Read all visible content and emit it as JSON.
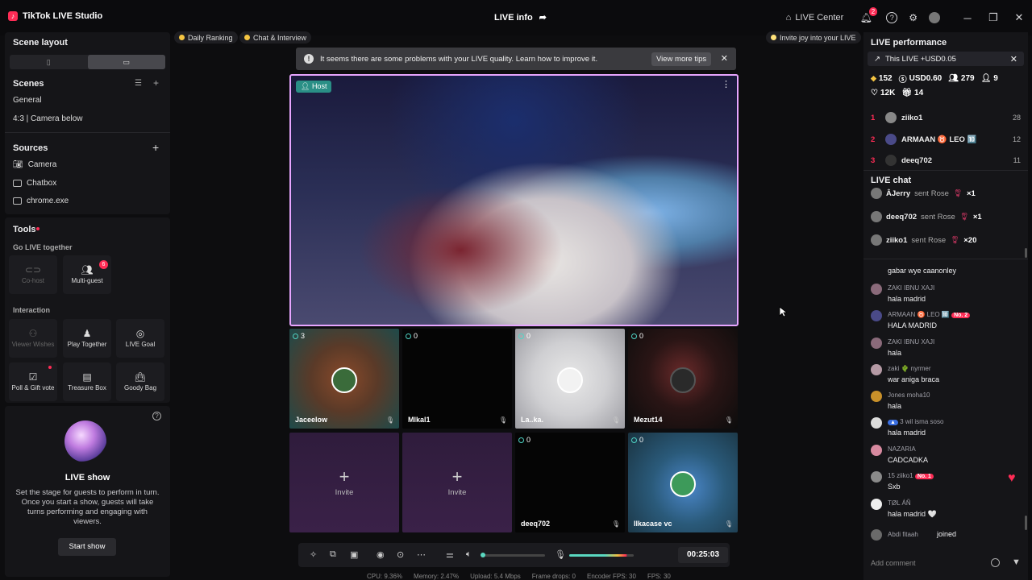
{
  "titlebar": {
    "app_title": "TikTok LIVE Studio",
    "live_info": "LIVE info",
    "live_center": "LIVE Center",
    "notif_count": "2"
  },
  "left": {
    "scene_layout": "Scene layout",
    "scenes": "Scenes",
    "scene_items": [
      "General",
      "4:3 | Camera below"
    ],
    "sources": "Sources",
    "source_items": [
      "Camera",
      "Chatbox",
      "chrome.exe"
    ],
    "tools": "Tools",
    "go_live_together": "Go LIVE together",
    "cohost": "Co-host",
    "multiguest": "Multi-guest",
    "multiguest_badge": "6",
    "interaction": "Interaction",
    "viewer_wishes": "Viewer Wishes",
    "play_together": "Play Together",
    "live_goal": "LIVE Goal",
    "poll_gift": "Poll & Gift vote",
    "treasure_box": "Treasure Box",
    "goody_bag": "Goody Bag",
    "live_show_title": "LIVE show",
    "live_show_desc": "Set the stage for guests to perform in turn. Once you start a show, guests will take turns performing and engaging with viewers.",
    "start_show": "Start show"
  },
  "center": {
    "daily_ranking": "Daily Ranking",
    "chat_interview": "Chat & Interview",
    "invite_joy": "Invite joy into your LIVE",
    "alert_text": "It seems there are some problems with your LIVE quality. Learn how to improve it.",
    "view_more_tips": "View more tips",
    "host_tag": "Host",
    "guests": [
      {
        "count": "3",
        "name": "Jaceelow"
      },
      {
        "count": "0",
        "name": "Mlkal1"
      },
      {
        "count": "0",
        "name": "La..ka."
      },
      {
        "count": "0",
        "name": "Mezut14"
      },
      {
        "count": "0",
        "name": "deeq702"
      },
      {
        "count": "0",
        "name": "Ilkacase vc"
      }
    ],
    "invite_label": "Invite",
    "timer": "00:25:03",
    "stats": [
      "CPU: 9.36%",
      "Memory: 2.47%",
      "Upload: 5.4 Mbps",
      "Frame drops: 0",
      "Encoder FPS: 30",
      "FPS: 30"
    ]
  },
  "right": {
    "live_performance": "LIVE performance",
    "this_live": "This LIVE +USD0.05",
    "metrics": {
      "diamonds": "152",
      "usd": "USD0.60",
      "viewers": "279",
      "new_followers": "9",
      "likes": "12K",
      "gifters": "14"
    },
    "ranking": [
      {
        "rank": "1",
        "name": "ziiko1",
        "score": "28"
      },
      {
        "rank": "2",
        "name": "ARMAAN ♉ LEO 🔟",
        "score": "12"
      },
      {
        "rank": "3",
        "name": "deeq702",
        "score": "11"
      }
    ],
    "live_chat": "LIVE chat",
    "gifts": [
      {
        "user": "ÂJerry",
        "sent": "sent Rose",
        "count": "×1"
      },
      {
        "user": "deeq702",
        "sent": "sent Rose",
        "count": "×1"
      },
      {
        "user": "ziiko1",
        "sent": "sent Rose",
        "count": "×20"
      }
    ],
    "chat": [
      {
        "user": "",
        "msg": "gabar wye caanonley"
      },
      {
        "user": "ZAKI IBNU XAJI",
        "msg": "hala madrid"
      },
      {
        "user": "ARMAAN ♉ LEO 🔟",
        "badge": "No. 2",
        "msg": "HALA MADRID"
      },
      {
        "user": "ZAKI IBNU XAJI",
        "msg": "hala"
      },
      {
        "user": "zaki 🌵 nyrmer",
        "msg": "war aniga braca"
      },
      {
        "user": "Jones moha10",
        "msg": "hala"
      },
      {
        "user": "3 wil isma soso",
        "msg": "hala madrid"
      },
      {
        "user": "NAZARIA",
        "msg": "CADCADKA"
      },
      {
        "user": "15 ziiko1",
        "badge": "No. 1",
        "msg": "Sxb"
      },
      {
        "user": "TØL ÁÑ",
        "msg": "hala madrid 🤍"
      },
      {
        "user": "Abdi fitaah",
        "msg": "joined"
      }
    ],
    "add_comment": "Add comment"
  }
}
